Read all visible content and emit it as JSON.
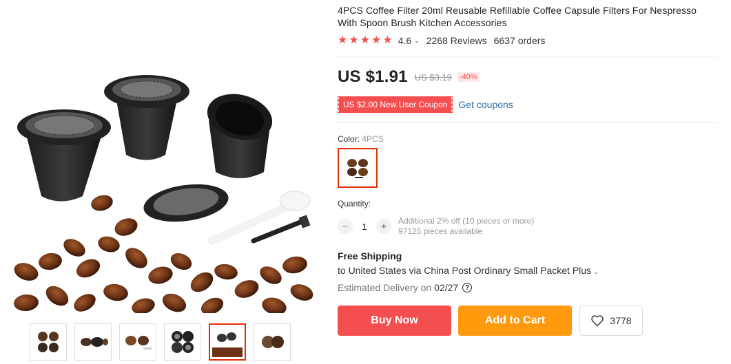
{
  "product": {
    "title": "4PCS Coffee Filter 20ml Reusable Refillable Coffee Capsule Filters For Nespresso With Spoon Brush Kitchen Accessories",
    "rating": "4.6",
    "rating_stars": 5,
    "reviews": "2268 Reviews",
    "orders": "6637 orders"
  },
  "price": {
    "current": "US $1.91",
    "original": "US $3.19",
    "discount": "-40%"
  },
  "coupon": {
    "label": "US $2.00 New User Coupon",
    "link": "Get coupons"
  },
  "color": {
    "label": "Color:",
    "value": "4PCS"
  },
  "quantity": {
    "label": "Quantity:",
    "value": "1",
    "decrement": "−",
    "increment": "+",
    "note_line1": "Additional 2% off (10 pieces or more)",
    "note_line2": "97125 pieces available"
  },
  "shipping": {
    "title": "Free Shipping",
    "detail": "to United States via China Post Ordinary Small Packet Plus",
    "delivery_label": "Estimated Delivery on",
    "delivery_date": "02/27",
    "help": "?"
  },
  "actions": {
    "buy_now": "Buy Now",
    "add_to_cart": "Add to Cart",
    "wishlist_count": "3778"
  },
  "colors": {
    "accent_red": "#f44f4f",
    "cart_orange": "#ff9a0e",
    "link_blue": "#2e6da4",
    "selected_border": "#e62e04"
  },
  "thumbnails": [
    {
      "icon": "thumb-capsules-icon"
    },
    {
      "icon": "thumb-capsules-icon"
    },
    {
      "icon": "thumb-capsules-icon"
    },
    {
      "icon": "thumb-filters-icon"
    },
    {
      "icon": "thumb-capsules-beans-icon"
    },
    {
      "icon": "thumb-capsules-icon"
    }
  ]
}
